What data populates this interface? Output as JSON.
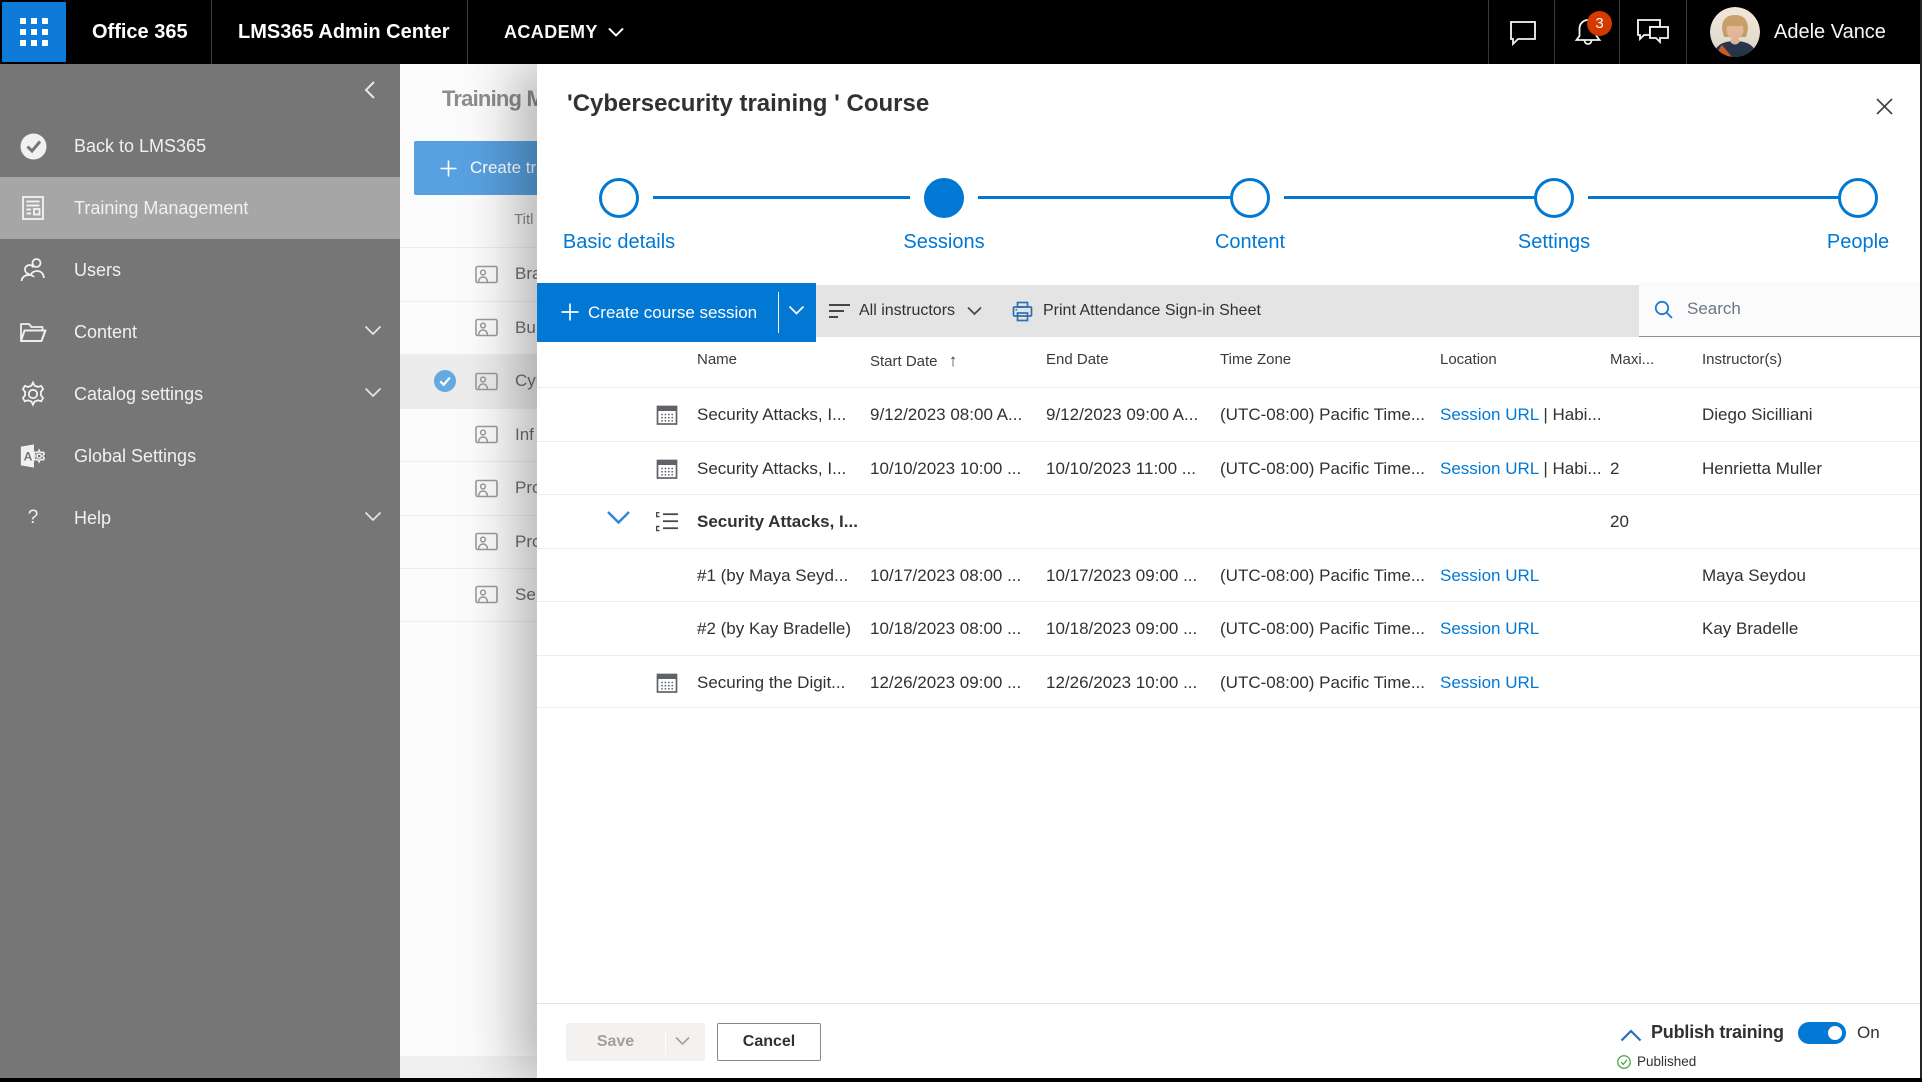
{
  "colors": {
    "accent": "#0078d4",
    "suite_bar": "#000000",
    "waffle_tile": "#0d7bd7",
    "notification_badge": "#d83b01",
    "sidebar": "#767676",
    "sidebar_active": "#a6a6a6",
    "published_green": "#3fa33f",
    "link": "#0078d4"
  },
  "top_bar": {
    "brand": "Office 365",
    "app_title": "LMS365 Admin Center",
    "tenant": "ACADEMY",
    "notification_count": "3",
    "user_name": "Adele Vance"
  },
  "sidebar": {
    "items": [
      {
        "label": "Back to LMS365",
        "icon": "back-check-circle-icon"
      },
      {
        "label": "Training Management",
        "icon": "training-management-icon",
        "active": true
      },
      {
        "label": "Users",
        "icon": "users-icon"
      },
      {
        "label": "Content",
        "icon": "folder-icon",
        "expandable": true
      },
      {
        "label": "Catalog settings",
        "icon": "gear-icon",
        "expandable": true
      },
      {
        "label": "Global Settings",
        "icon": "global-settings-icon"
      },
      {
        "label": "Help",
        "icon": "question-icon",
        "expandable": true
      }
    ]
  },
  "background_page": {
    "title": "Training M",
    "create_button_label": "Create tra",
    "column_header": "Titl",
    "rows": [
      {
        "label": "Bra"
      },
      {
        "label": "Bu"
      },
      {
        "label": "Cyb",
        "selected": true
      },
      {
        "label": "Inf"
      },
      {
        "label": "Pro"
      },
      {
        "label": "Pro"
      },
      {
        "label": "Se"
      }
    ]
  },
  "panel": {
    "title": "'Cybersecurity training ' Course",
    "steps": [
      {
        "label": "Basic details",
        "state": "default"
      },
      {
        "label": "Sessions",
        "state": "current"
      },
      {
        "label": "Content",
        "state": "default"
      },
      {
        "label": "Settings",
        "state": "default"
      },
      {
        "label": "People",
        "state": "default"
      }
    ],
    "toolbar": {
      "create_session_label": "Create course session",
      "instructors_filter": "All instructors",
      "print_label": "Print Attendance Sign-in Sheet",
      "search_placeholder": "Search"
    },
    "table": {
      "columns": {
        "name": "Name",
        "start": "Start Date",
        "end": "End Date",
        "tz": "Time Zone",
        "loc": "Location",
        "max": "Maxi...",
        "ins": "Instructor(s)"
      },
      "sort_indicator": "↑",
      "rows": [
        {
          "name": "Security Attacks, I...",
          "start": "9/12/2023 08:00 A...",
          "end": "9/12/2023 09:00 A...",
          "tz": "(UTC-08:00) Pacific Time...",
          "loc_link": "Session URL",
          "loc_extra": " | Habi...",
          "max": "",
          "ins": "Diego Sicilliani"
        },
        {
          "name": "Security Attacks, I...",
          "start": "10/10/2023 10:00 ...",
          "end": "10/10/2023 11:00 ...",
          "tz": "(UTC-08:00) Pacific Time...",
          "loc_link": "Session URL",
          "loc_extra": " | Habi...",
          "max": "2",
          "ins": "Henrietta Muller"
        },
        {
          "name": "Security Attacks, I...",
          "start": "",
          "end": "",
          "tz": "",
          "loc_link": "",
          "loc_extra": "",
          "max": "20",
          "ins": "",
          "group": true
        },
        {
          "name": "#1 (by Maya Seyd...",
          "start": "10/17/2023 08:00 ...",
          "end": "10/17/2023 09:00 ...",
          "tz": "(UTC-08:00) Pacific Time...",
          "loc_link": "Session URL",
          "loc_extra": "",
          "max": "",
          "ins": "Maya Seydou"
        },
        {
          "name": "#2 (by Kay Bradelle)",
          "start": "10/18/2023 08:00 ...",
          "end": "10/18/2023 09:00 ...",
          "tz": "(UTC-08:00) Pacific Time...",
          "loc_link": "Session URL",
          "loc_extra": "",
          "max": "",
          "ins": "Kay Bradelle"
        },
        {
          "name": "Securing the Digit...",
          "start": "12/26/2023 09:00 ...",
          "end": "12/26/2023 10:00 ...",
          "tz": "(UTC-08:00) Pacific Time...",
          "loc_link": "Session URL",
          "loc_extra": "",
          "max": "",
          "ins": ""
        }
      ]
    },
    "footer": {
      "save_label": "Save",
      "cancel_label": "Cancel",
      "publish_label": "Publish training",
      "toggle_state": "On",
      "status_label": "Published"
    }
  }
}
